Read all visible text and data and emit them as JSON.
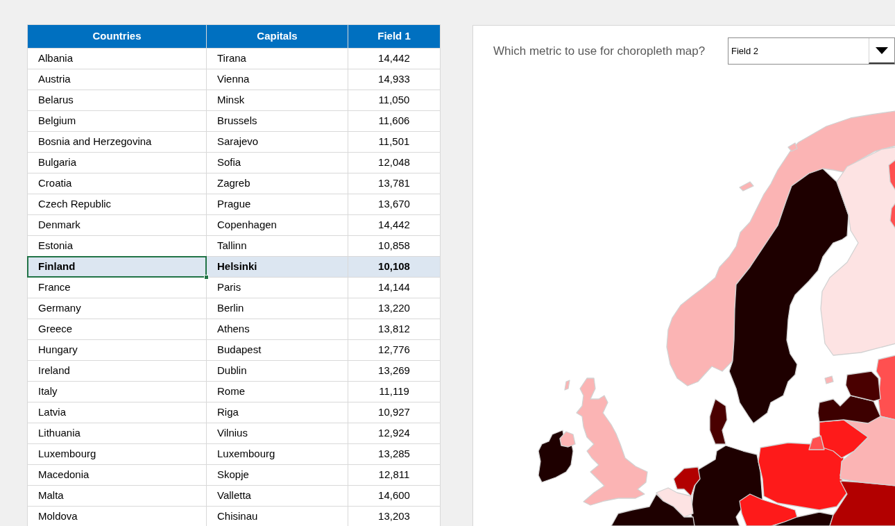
{
  "table": {
    "columns": [
      "Countries",
      "Capitals",
      "Field 1"
    ],
    "rows": [
      {
        "cells": [
          "Albania",
          "Tirana",
          "14,442"
        ],
        "selected": false
      },
      {
        "cells": [
          "Austria",
          "Vienna",
          "14,933"
        ],
        "selected": false
      },
      {
        "cells": [
          "Belarus",
          "Minsk",
          "11,050"
        ],
        "selected": false
      },
      {
        "cells": [
          "Belgium",
          "Brussels",
          "11,606"
        ],
        "selected": false
      },
      {
        "cells": [
          "Bosnia and Herzegovina",
          "Sarajevo",
          "11,501"
        ],
        "selected": false
      },
      {
        "cells": [
          "Bulgaria",
          "Sofia",
          "12,048"
        ],
        "selected": false
      },
      {
        "cells": [
          "Croatia",
          "Zagreb",
          "13,781"
        ],
        "selected": false
      },
      {
        "cells": [
          "Czech Republic",
          "Prague",
          "13,670"
        ],
        "selected": false
      },
      {
        "cells": [
          "Denmark",
          "Copenhagen",
          "14,442"
        ],
        "selected": false
      },
      {
        "cells": [
          "Estonia",
          "Tallinn",
          "10,858"
        ],
        "selected": false
      },
      {
        "cells": [
          "Finland",
          "Helsinki",
          "10,108"
        ],
        "selected": true
      },
      {
        "cells": [
          "France",
          "Paris",
          "14,144"
        ],
        "selected": false
      },
      {
        "cells": [
          "Germany",
          "Berlin",
          "13,220"
        ],
        "selected": false
      },
      {
        "cells": [
          "Greece",
          "Athens",
          "13,812"
        ],
        "selected": false
      },
      {
        "cells": [
          "Hungary",
          "Budapest",
          "12,776"
        ],
        "selected": false
      },
      {
        "cells": [
          "Ireland",
          "Dublin",
          "13,269"
        ],
        "selected": false
      },
      {
        "cells": [
          "Italy",
          "Rome",
          "11,119"
        ],
        "selected": false
      },
      {
        "cells": [
          "Latvia",
          "Riga",
          "10,927"
        ],
        "selected": false
      },
      {
        "cells": [
          "Lithuania",
          "Vilnius",
          "12,924"
        ],
        "selected": false
      },
      {
        "cells": [
          "Luxembourg",
          "Luxembourg",
          "13,285"
        ],
        "selected": false
      },
      {
        "cells": [
          "Macedonia",
          "Skopje",
          "12,811"
        ],
        "selected": false
      },
      {
        "cells": [
          "Malta",
          "Valletta",
          "14,600"
        ],
        "selected": false
      },
      {
        "cells": [
          "Moldova",
          "Chisinau",
          "13,203"
        ],
        "selected": false
      }
    ]
  },
  "metric_picker": {
    "label": "Which metric to use for choropleth map?",
    "value": "Field 2"
  }
}
